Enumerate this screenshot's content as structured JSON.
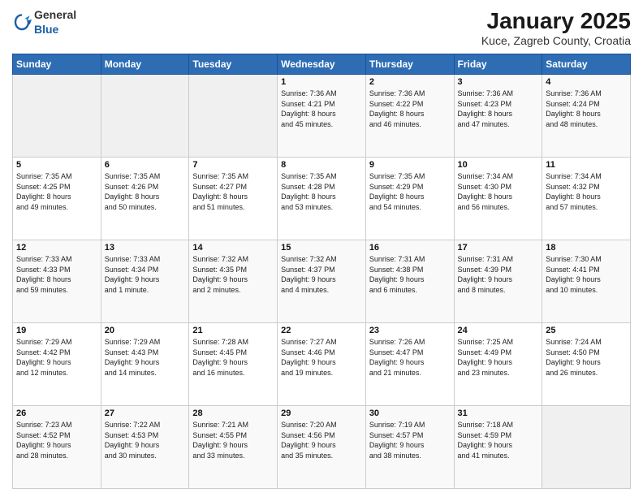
{
  "header": {
    "logo_general": "General",
    "logo_blue": "Blue",
    "title": "January 2025",
    "location": "Kuce, Zagreb County, Croatia"
  },
  "weekdays": [
    "Sunday",
    "Monday",
    "Tuesday",
    "Wednesday",
    "Thursday",
    "Friday",
    "Saturday"
  ],
  "weeks": [
    [
      {
        "day": "",
        "lines": []
      },
      {
        "day": "",
        "lines": []
      },
      {
        "day": "",
        "lines": []
      },
      {
        "day": "1",
        "lines": [
          "Sunrise: 7:36 AM",
          "Sunset: 4:21 PM",
          "Daylight: 8 hours",
          "and 45 minutes."
        ]
      },
      {
        "day": "2",
        "lines": [
          "Sunrise: 7:36 AM",
          "Sunset: 4:22 PM",
          "Daylight: 8 hours",
          "and 46 minutes."
        ]
      },
      {
        "day": "3",
        "lines": [
          "Sunrise: 7:36 AM",
          "Sunset: 4:23 PM",
          "Daylight: 8 hours",
          "and 47 minutes."
        ]
      },
      {
        "day": "4",
        "lines": [
          "Sunrise: 7:36 AM",
          "Sunset: 4:24 PM",
          "Daylight: 8 hours",
          "and 48 minutes."
        ]
      }
    ],
    [
      {
        "day": "5",
        "lines": [
          "Sunrise: 7:35 AM",
          "Sunset: 4:25 PM",
          "Daylight: 8 hours",
          "and 49 minutes."
        ]
      },
      {
        "day": "6",
        "lines": [
          "Sunrise: 7:35 AM",
          "Sunset: 4:26 PM",
          "Daylight: 8 hours",
          "and 50 minutes."
        ]
      },
      {
        "day": "7",
        "lines": [
          "Sunrise: 7:35 AM",
          "Sunset: 4:27 PM",
          "Daylight: 8 hours",
          "and 51 minutes."
        ]
      },
      {
        "day": "8",
        "lines": [
          "Sunrise: 7:35 AM",
          "Sunset: 4:28 PM",
          "Daylight: 8 hours",
          "and 53 minutes."
        ]
      },
      {
        "day": "9",
        "lines": [
          "Sunrise: 7:35 AM",
          "Sunset: 4:29 PM",
          "Daylight: 8 hours",
          "and 54 minutes."
        ]
      },
      {
        "day": "10",
        "lines": [
          "Sunrise: 7:34 AM",
          "Sunset: 4:30 PM",
          "Daylight: 8 hours",
          "and 56 minutes."
        ]
      },
      {
        "day": "11",
        "lines": [
          "Sunrise: 7:34 AM",
          "Sunset: 4:32 PM",
          "Daylight: 8 hours",
          "and 57 minutes."
        ]
      }
    ],
    [
      {
        "day": "12",
        "lines": [
          "Sunrise: 7:33 AM",
          "Sunset: 4:33 PM",
          "Daylight: 8 hours",
          "and 59 minutes."
        ]
      },
      {
        "day": "13",
        "lines": [
          "Sunrise: 7:33 AM",
          "Sunset: 4:34 PM",
          "Daylight: 9 hours",
          "and 1 minute."
        ]
      },
      {
        "day": "14",
        "lines": [
          "Sunrise: 7:32 AM",
          "Sunset: 4:35 PM",
          "Daylight: 9 hours",
          "and 2 minutes."
        ]
      },
      {
        "day": "15",
        "lines": [
          "Sunrise: 7:32 AM",
          "Sunset: 4:37 PM",
          "Daylight: 9 hours",
          "and 4 minutes."
        ]
      },
      {
        "day": "16",
        "lines": [
          "Sunrise: 7:31 AM",
          "Sunset: 4:38 PM",
          "Daylight: 9 hours",
          "and 6 minutes."
        ]
      },
      {
        "day": "17",
        "lines": [
          "Sunrise: 7:31 AM",
          "Sunset: 4:39 PM",
          "Daylight: 9 hours",
          "and 8 minutes."
        ]
      },
      {
        "day": "18",
        "lines": [
          "Sunrise: 7:30 AM",
          "Sunset: 4:41 PM",
          "Daylight: 9 hours",
          "and 10 minutes."
        ]
      }
    ],
    [
      {
        "day": "19",
        "lines": [
          "Sunrise: 7:29 AM",
          "Sunset: 4:42 PM",
          "Daylight: 9 hours",
          "and 12 minutes."
        ]
      },
      {
        "day": "20",
        "lines": [
          "Sunrise: 7:29 AM",
          "Sunset: 4:43 PM",
          "Daylight: 9 hours",
          "and 14 minutes."
        ]
      },
      {
        "day": "21",
        "lines": [
          "Sunrise: 7:28 AM",
          "Sunset: 4:45 PM",
          "Daylight: 9 hours",
          "and 16 minutes."
        ]
      },
      {
        "day": "22",
        "lines": [
          "Sunrise: 7:27 AM",
          "Sunset: 4:46 PM",
          "Daylight: 9 hours",
          "and 19 minutes."
        ]
      },
      {
        "day": "23",
        "lines": [
          "Sunrise: 7:26 AM",
          "Sunset: 4:47 PM",
          "Daylight: 9 hours",
          "and 21 minutes."
        ]
      },
      {
        "day": "24",
        "lines": [
          "Sunrise: 7:25 AM",
          "Sunset: 4:49 PM",
          "Daylight: 9 hours",
          "and 23 minutes."
        ]
      },
      {
        "day": "25",
        "lines": [
          "Sunrise: 7:24 AM",
          "Sunset: 4:50 PM",
          "Daylight: 9 hours",
          "and 26 minutes."
        ]
      }
    ],
    [
      {
        "day": "26",
        "lines": [
          "Sunrise: 7:23 AM",
          "Sunset: 4:52 PM",
          "Daylight: 9 hours",
          "and 28 minutes."
        ]
      },
      {
        "day": "27",
        "lines": [
          "Sunrise: 7:22 AM",
          "Sunset: 4:53 PM",
          "Daylight: 9 hours",
          "and 30 minutes."
        ]
      },
      {
        "day": "28",
        "lines": [
          "Sunrise: 7:21 AM",
          "Sunset: 4:55 PM",
          "Daylight: 9 hours",
          "and 33 minutes."
        ]
      },
      {
        "day": "29",
        "lines": [
          "Sunrise: 7:20 AM",
          "Sunset: 4:56 PM",
          "Daylight: 9 hours",
          "and 35 minutes."
        ]
      },
      {
        "day": "30",
        "lines": [
          "Sunrise: 7:19 AM",
          "Sunset: 4:57 PM",
          "Daylight: 9 hours",
          "and 38 minutes."
        ]
      },
      {
        "day": "31",
        "lines": [
          "Sunrise: 7:18 AM",
          "Sunset: 4:59 PM",
          "Daylight: 9 hours",
          "and 41 minutes."
        ]
      },
      {
        "day": "",
        "lines": []
      }
    ]
  ]
}
